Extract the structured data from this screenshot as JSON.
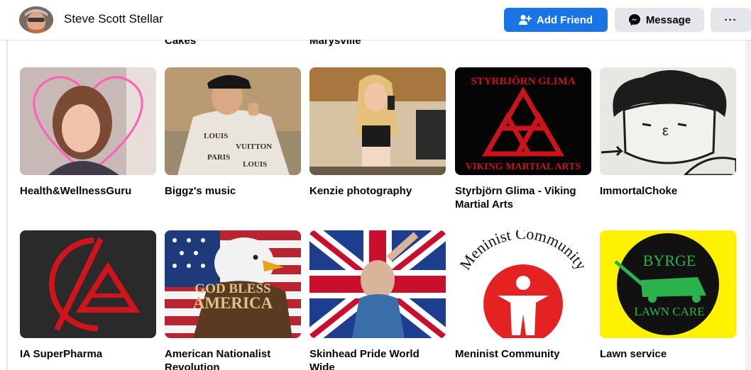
{
  "profile": {
    "name": "Steve Scott Stellar",
    "add_friend": "Add Friend",
    "message": "Message",
    "more": "···"
  },
  "partial_labels": [
    "Cakes",
    "Marysville"
  ],
  "pages": [
    {
      "name": "Health&WellnessGuru"
    },
    {
      "name": "Biggz's music"
    },
    {
      "name": "Kenzie photography"
    },
    {
      "name": "Styrbjörn Glima - Viking Martial Arts"
    },
    {
      "name": "ImmortalChoke"
    },
    {
      "name": "IA SuperPharma"
    },
    {
      "name": "American Nationalist Revolution"
    },
    {
      "name": "Skinhead Pride World Wide"
    },
    {
      "name": "Meninist Community"
    },
    {
      "name": "Lawn service"
    }
  ],
  "thumb_text": {
    "styrbjorn_top": "STYRBJÖRN GLIMA",
    "styrbjorn_bottom": "VIKING MARTIAL ARTS",
    "american_line1": "GOD BLESS",
    "american_line2": "AMERICA",
    "meninist_arc": "Meninist Community",
    "byrge_top": "BYRGE",
    "byrge_bottom": "LAWN CARE"
  },
  "colors": {
    "accent": "#1b74e4",
    "secondary_button": "#e4e6eb",
    "viking_red": "#c8141a",
    "meninist_red": "#e52222",
    "lawn_yellow": "#fff200",
    "lawn_green": "#2bb24c"
  }
}
